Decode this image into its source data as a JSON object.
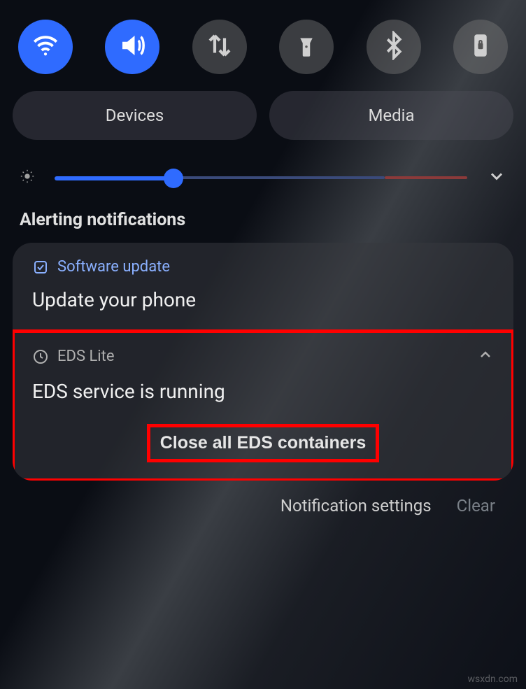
{
  "quickSettings": {
    "wifi": "wifi-icon",
    "sound": "volume-icon",
    "data": "data-swap-icon",
    "flashlight": "flashlight-icon",
    "bluetooth": "bluetooth-icon",
    "rotation": "rotation-lock-icon"
  },
  "chips": {
    "devices": "Devices",
    "media": "Media"
  },
  "sectionHeading": "Alerting notifications",
  "notifications": [
    {
      "app": "Software update",
      "title": "Update your phone"
    },
    {
      "app": "EDS Lite",
      "title": "EDS service is running",
      "action": "Close all EDS containers"
    }
  ],
  "footer": {
    "settings": "Notification settings",
    "clear": "Clear"
  },
  "watermark": "wsxdn.com"
}
